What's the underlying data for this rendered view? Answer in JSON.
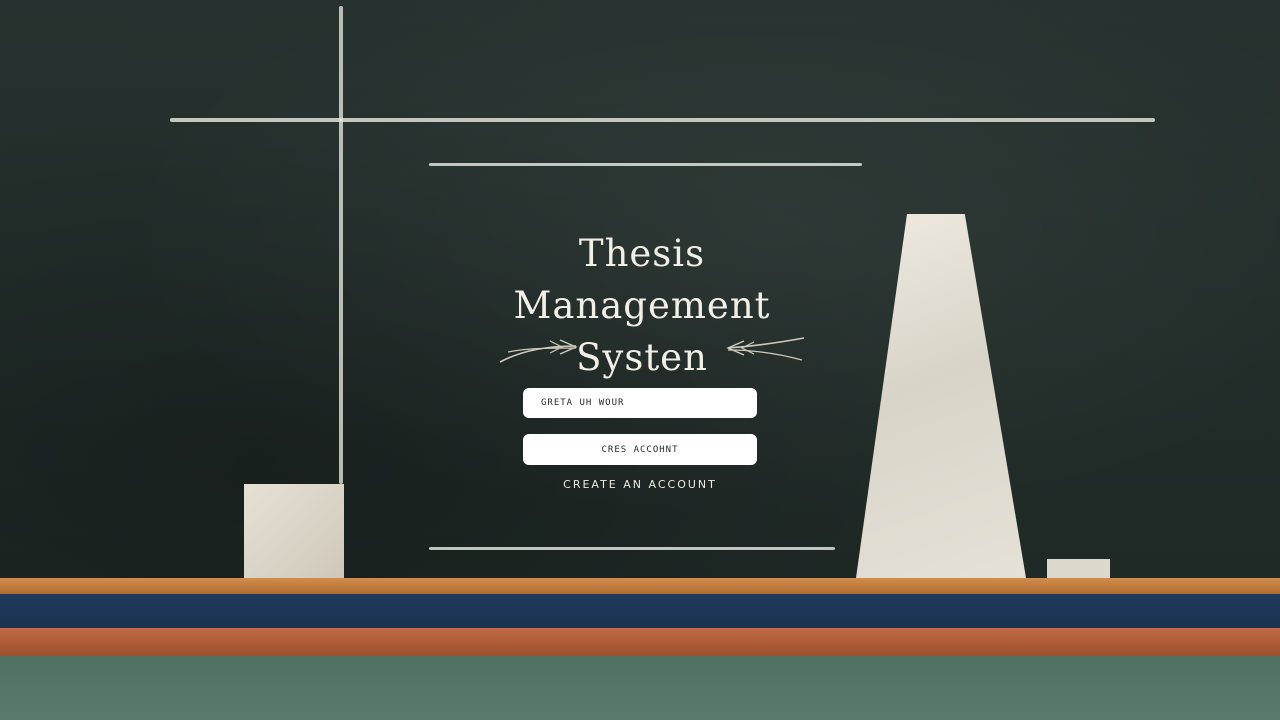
{
  "app": {
    "title_lines": [
      "Thesis",
      "Management",
      "Systen"
    ]
  },
  "form": {
    "field_value": "GRETA UH WOUR",
    "button_label": "CRES ACCOHNT",
    "link_label": "CREATE AN ACCOUNT"
  },
  "colors": {
    "chalkboard": "#24302d",
    "chalk": "#f2efe6",
    "ledge_wood": "#c07c3e",
    "ledge_band": "#203a5c",
    "floor": "#52705f"
  }
}
